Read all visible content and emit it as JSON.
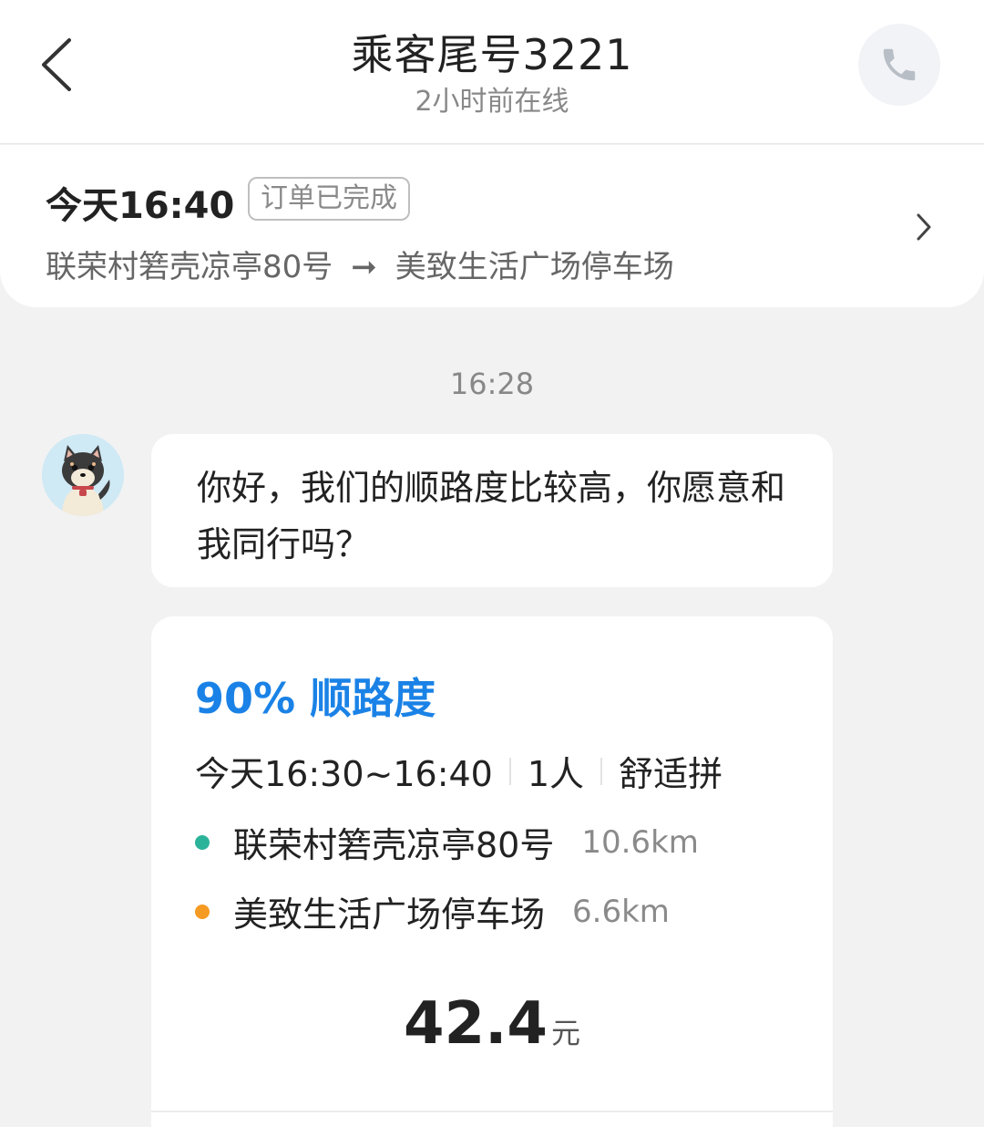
{
  "header": {
    "title": "乘客尾号3221",
    "subtitle": "2小时前在线"
  },
  "order": {
    "time": "今天16:40",
    "status": "订单已完成",
    "from": "联荣村箬壳凉亭80号",
    "arrow": "➞",
    "to": "美致生活广场停车场"
  },
  "chat": {
    "timestamp": "16:28",
    "message": "你好，我们的顺路度比较高，你愿意和我同行吗？"
  },
  "trip": {
    "match_percent": "90%",
    "match_label": "顺路度",
    "time_range": "今天16:30~16:40",
    "passengers": "1人",
    "ride_type": "舒适拼",
    "start": {
      "name": "联荣村箬壳凉亭80号",
      "distance": "10.6km",
      "dot_color": "#2bb39a"
    },
    "end": {
      "name": "美致生活广场停车场",
      "distance": "6.6km",
      "dot_color": "#f59a23"
    },
    "price": "42.4",
    "price_unit": "元"
  },
  "colors": {
    "accent": "#1a82e6",
    "start_dot": "#2bb39a",
    "end_dot": "#f59a23"
  },
  "icons": {
    "back": "chevron-left-icon",
    "call": "phone-icon",
    "order_detail": "chevron-right-icon"
  }
}
